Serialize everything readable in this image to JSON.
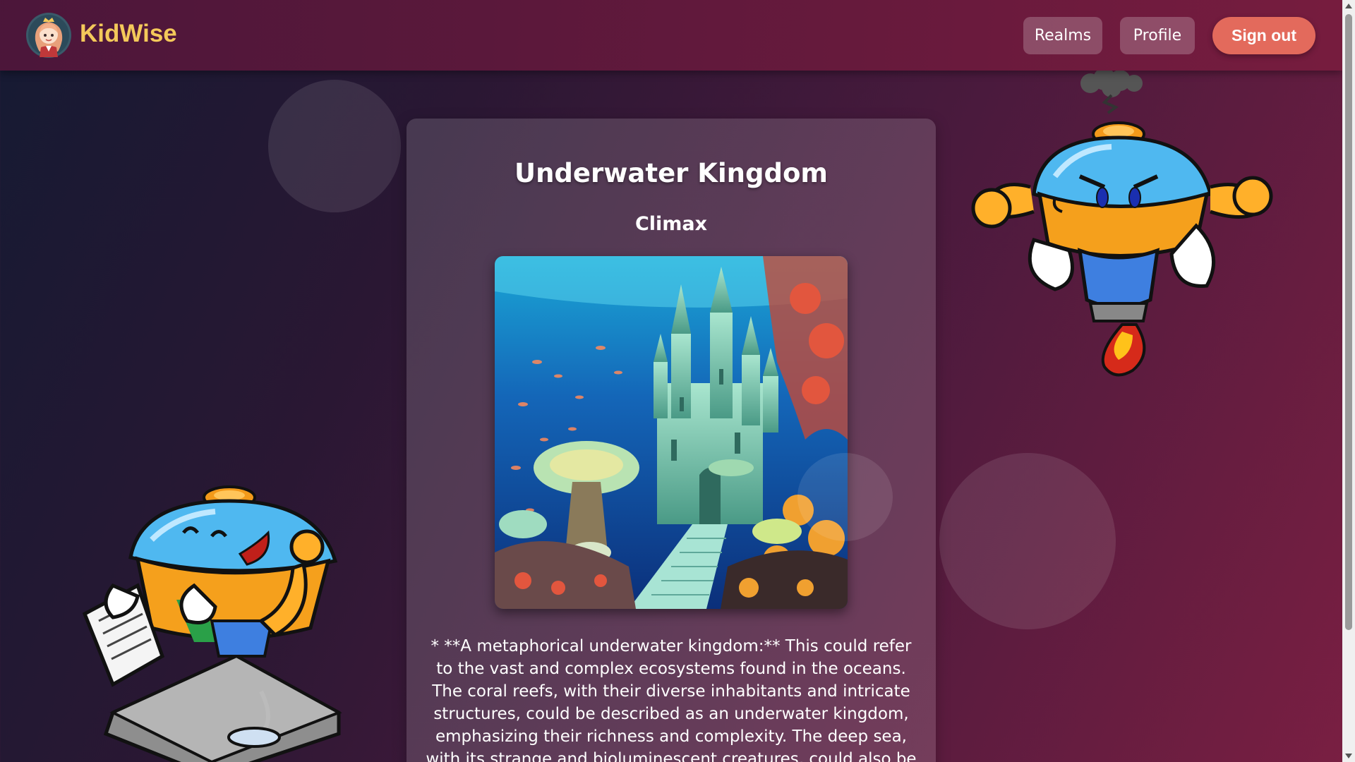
{
  "app": {
    "brand": "KidWise",
    "logo_icon": "princess-avatar-icon"
  },
  "nav": {
    "realms_label": "Realms",
    "profile_label": "Profile",
    "signout_label": "Sign out"
  },
  "story": {
    "title": "Underwater Kingdom",
    "chapter": "Climax",
    "image_icon": "underwater-castle-illustration",
    "text": "* **A metaphorical underwater kingdom:** This could refer to the vast and complex ecosystems found in the oceans. The coral reefs, with their diverse inhabitants and intricate structures, could be described as an underwater kingdom, emphasizing their richness and complexity. The deep sea, with its strange and bioluminescent creatures, could also be considered an"
  },
  "decor": {
    "right_mascot_icon": "angry-robot-mascot-icon",
    "left_mascot_icon": "laughing-robot-mascot-icon"
  },
  "colors": {
    "brand": "#f4c95a",
    "signout": "#e36a5c",
    "navbar": "#5a1a3e"
  }
}
